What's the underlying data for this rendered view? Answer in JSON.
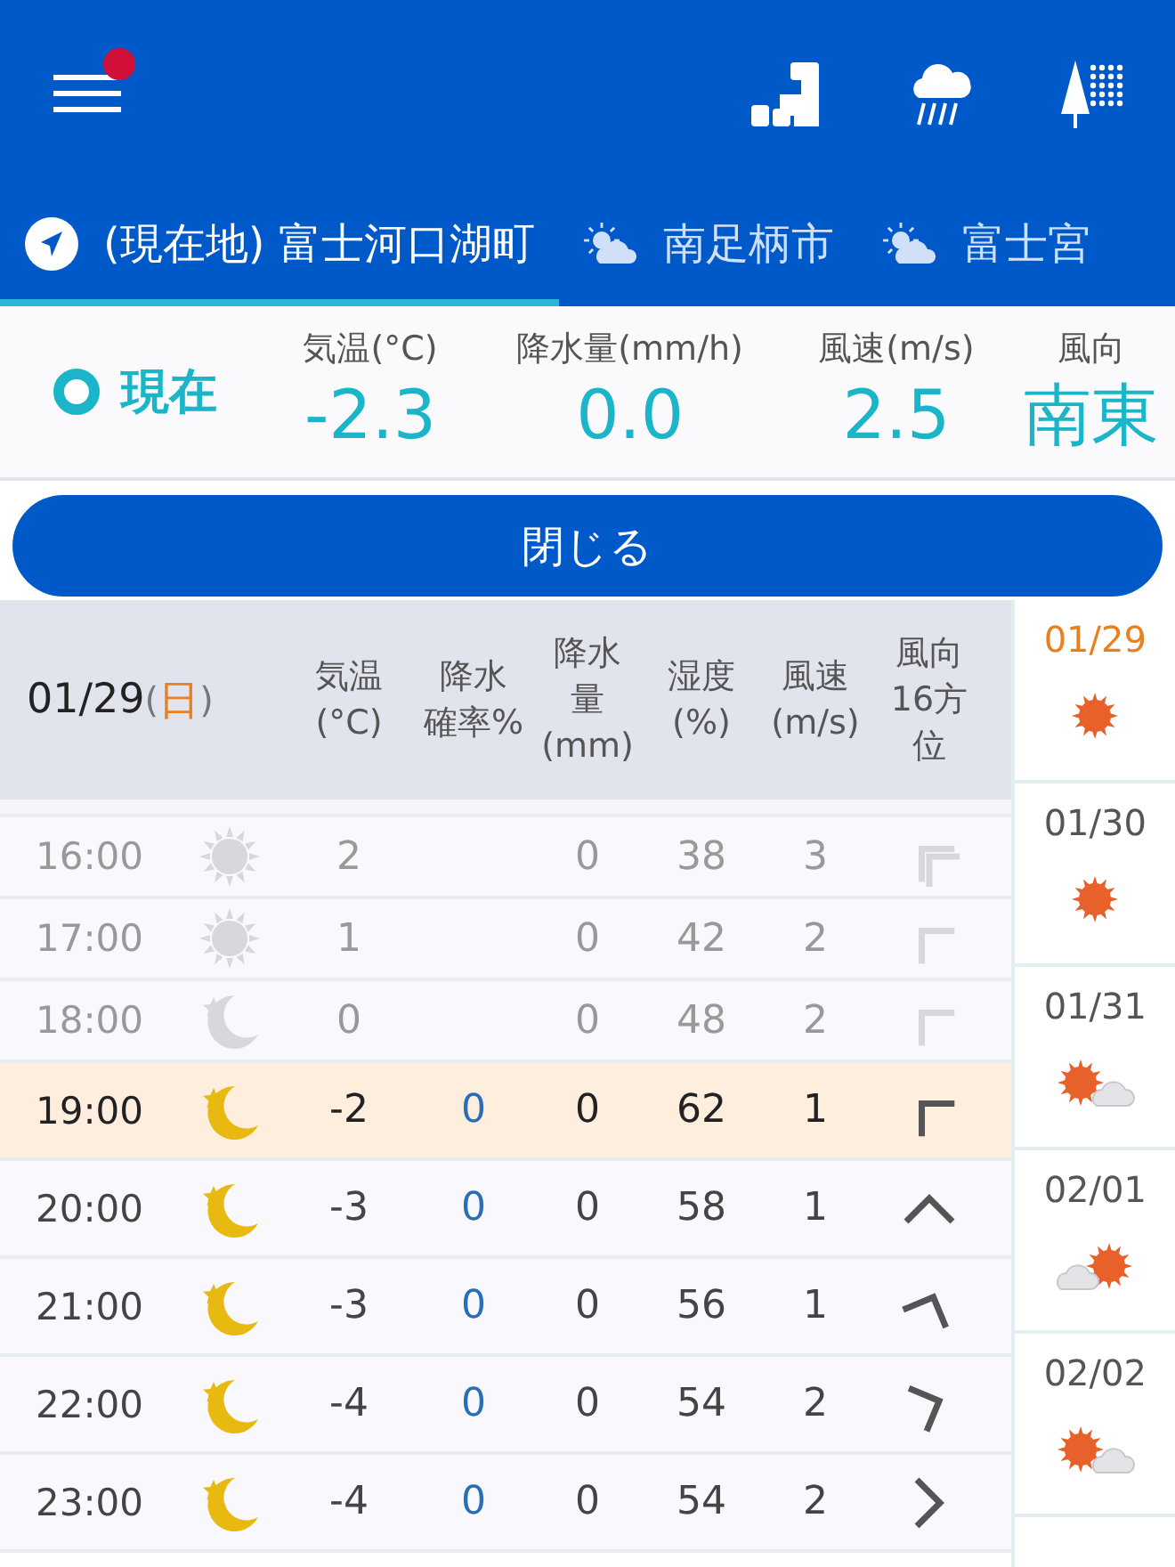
{
  "app_bar": {
    "notification_dot": true
  },
  "location_tabs": [
    {
      "label": "(現在地) 富士河口湖町",
      "selected": true,
      "kind": "current_location"
    },
    {
      "label": "南足柄市",
      "selected": false,
      "kind": "partly_cloudy"
    },
    {
      "label": "富士宮",
      "selected": false,
      "kind": "partly_cloudy"
    }
  ],
  "current": {
    "label": "現在",
    "stats": [
      {
        "label": "気温(°C)",
        "value": "-2.3"
      },
      {
        "label": "降水量(mm/h)",
        "value": "0.0"
      },
      {
        "label": "風速(m/s)",
        "value": "2.5"
      },
      {
        "label": "風向",
        "value": "南東"
      }
    ]
  },
  "close_button": "閉じる",
  "table": {
    "date": "01/29",
    "open_bracket": "(",
    "weekday": "日",
    "close_bracket": ")",
    "columns": [
      {
        "lines": [
          "気温",
          "(°C)"
        ]
      },
      {
        "lines": [
          "降水",
          "確率%"
        ]
      },
      {
        "lines": [
          "降水",
          "量",
          "(mm)"
        ]
      },
      {
        "lines": [
          "湿度",
          "(%)"
        ]
      },
      {
        "lines": [
          "風速",
          "(m/s)"
        ]
      },
      {
        "lines": [
          "風向",
          "16方",
          "位"
        ]
      }
    ],
    "rows": [
      {
        "time": "16:00",
        "kind": "sun",
        "temperature": "2",
        "precip_amount": "0",
        "humidity": "38",
        "wind_speed": "3",
        "wind_arrow": {
          "kind": "northwest",
          "double": true
        },
        "past": true,
        "current": false
      },
      {
        "time": "17:00",
        "kind": "sun",
        "temperature": "1",
        "precip_amount": "0",
        "humidity": "42",
        "wind_speed": "2",
        "wind_arrow": {
          "kind": "northwest",
          "double": false
        },
        "past": true,
        "current": false
      },
      {
        "time": "18:00",
        "kind": "moon",
        "temperature": "0",
        "precip_amount": "0",
        "humidity": "48",
        "wind_speed": "2",
        "wind_arrow": {
          "kind": "northwest",
          "double": false
        },
        "past": true,
        "current": false
      },
      {
        "time": "19:00",
        "kind": "moon",
        "temperature": "-2",
        "precip_probability": "0",
        "precip_amount": "0",
        "humidity": "62",
        "wind_speed": "1",
        "wind_arrow": {
          "kind": "northwest",
          "double": false
        },
        "past": false,
        "current": true
      },
      {
        "time": "20:00",
        "kind": "moon",
        "temperature": "-3",
        "precip_probability": "0",
        "precip_amount": "0",
        "humidity": "58",
        "wind_speed": "1",
        "wind_arrow": {
          "kind": "north",
          "double": false
        },
        "past": false,
        "current": false
      },
      {
        "time": "21:00",
        "kind": "moon",
        "temperature": "-3",
        "precip_probability": "0",
        "precip_amount": "0",
        "humidity": "56",
        "wind_speed": "1",
        "wind_arrow": {
          "kind": "north_northeast",
          "double": false
        },
        "past": false,
        "current": false
      },
      {
        "time": "22:00",
        "kind": "moon",
        "temperature": "-4",
        "precip_probability": "0",
        "precip_amount": "0",
        "humidity": "54",
        "wind_speed": "2",
        "wind_arrow": {
          "kind": "east_northeast",
          "double": false
        },
        "past": false,
        "current": false
      },
      {
        "time": "23:00",
        "kind": "moon",
        "temperature": "-4",
        "precip_probability": "0",
        "precip_amount": "0",
        "humidity": "54",
        "wind_speed": "2",
        "wind_arrow": {
          "kind": "east",
          "double": false
        },
        "past": false,
        "current": false
      }
    ]
  },
  "days": [
    {
      "date": "01/29",
      "kind": "sunny",
      "selected": true
    },
    {
      "date": "01/30",
      "kind": "sunny",
      "selected": false
    },
    {
      "date": "01/31",
      "kind": "sunny_cloudy",
      "selected": false
    },
    {
      "date": "02/01",
      "kind": "cloudy_sunny",
      "selected": false
    },
    {
      "date": "02/02",
      "kind": "sunny_cloudy",
      "selected": false
    }
  ]
}
